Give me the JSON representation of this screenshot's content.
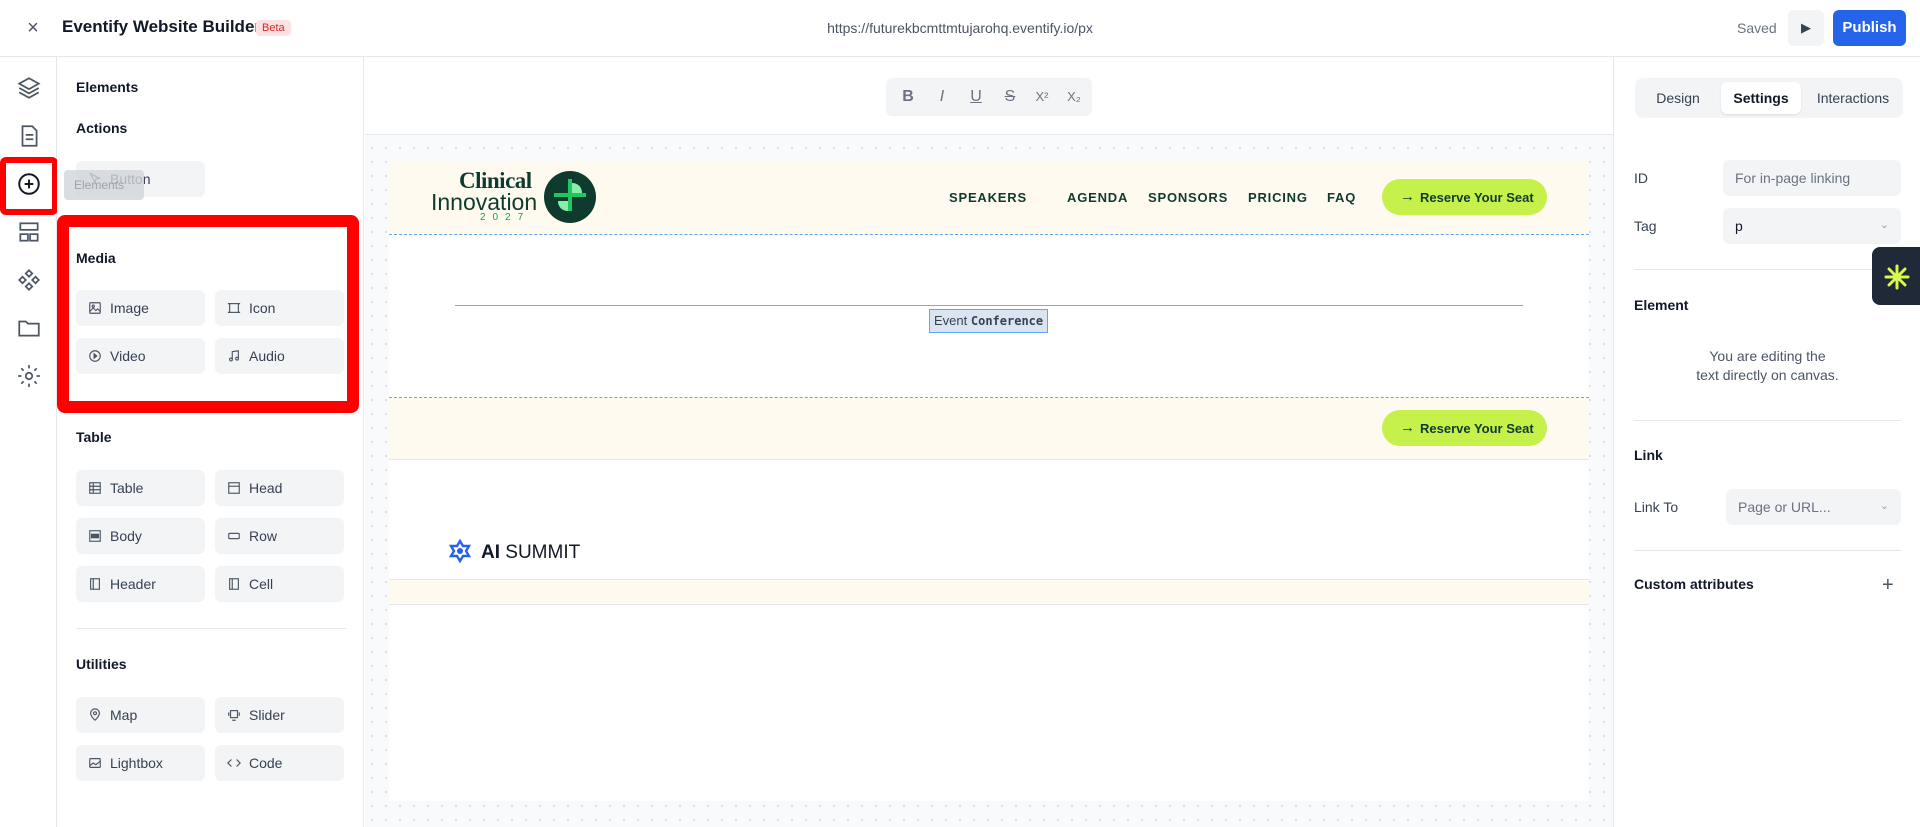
{
  "topbar": {
    "title": "Eventify Website Builder",
    "badge": "Beta",
    "url": "https://futurekbcmttmtujarohq.eventify.io/px",
    "status": "Saved",
    "publish_label": "Publish"
  },
  "left_panel": {
    "elements_heading": "Elements",
    "actions_heading": "Actions",
    "button_label": "Button",
    "drag_ghost_label": "Elements",
    "media_heading": "Media",
    "media_items": [
      "Image",
      "Icon",
      "Video",
      "Audio"
    ],
    "table_heading": "Table",
    "table_items": [
      "Table",
      "Head",
      "Body",
      "Row",
      "Header",
      "Cell"
    ],
    "utilities_heading": "Utilities",
    "utilities_items": [
      "Map",
      "Slider",
      "Lightbox",
      "Code"
    ]
  },
  "format_toolbar": {
    "bold": "B",
    "italic": "I",
    "underline": "U",
    "strike": "S",
    "superscript": "X²",
    "subscript": "X₂"
  },
  "canvas": {
    "logo_line1": "Clinical",
    "logo_line2": "Innovation",
    "logo_year": "2027",
    "nav_links": [
      "SPEAKERS",
      "AGENDA",
      "SPONSORS",
      "PRICING",
      "FAQ"
    ],
    "cta_label": "Reserve Your Seat",
    "selected_text_plain": "Event",
    "selected_text_bold": "Conference",
    "ai_logo_bold": "AI",
    "ai_logo_rest": "SUMMIT"
  },
  "right_panel": {
    "tabs": [
      "Design",
      "Settings",
      "Interactions"
    ],
    "active_tab": "Settings",
    "id_label": "ID",
    "id_placeholder": "For in-page linking",
    "tag_label": "Tag",
    "tag_value": "p",
    "element_heading": "Element",
    "element_note_1": "You are editing the",
    "element_note_2": "text directly on canvas.",
    "link_heading": "Link",
    "link_to_label": "Link To",
    "link_to_value": "Page or URL...",
    "custom_attributes_heading": "Custom attributes"
  },
  "colors": {
    "accent_blue": "#2563eb",
    "cta_lime": "#c6f04a",
    "brand_green": "#0f3b2e",
    "highlight_red": "#ff0000",
    "band_cream": "#fefaf0"
  }
}
